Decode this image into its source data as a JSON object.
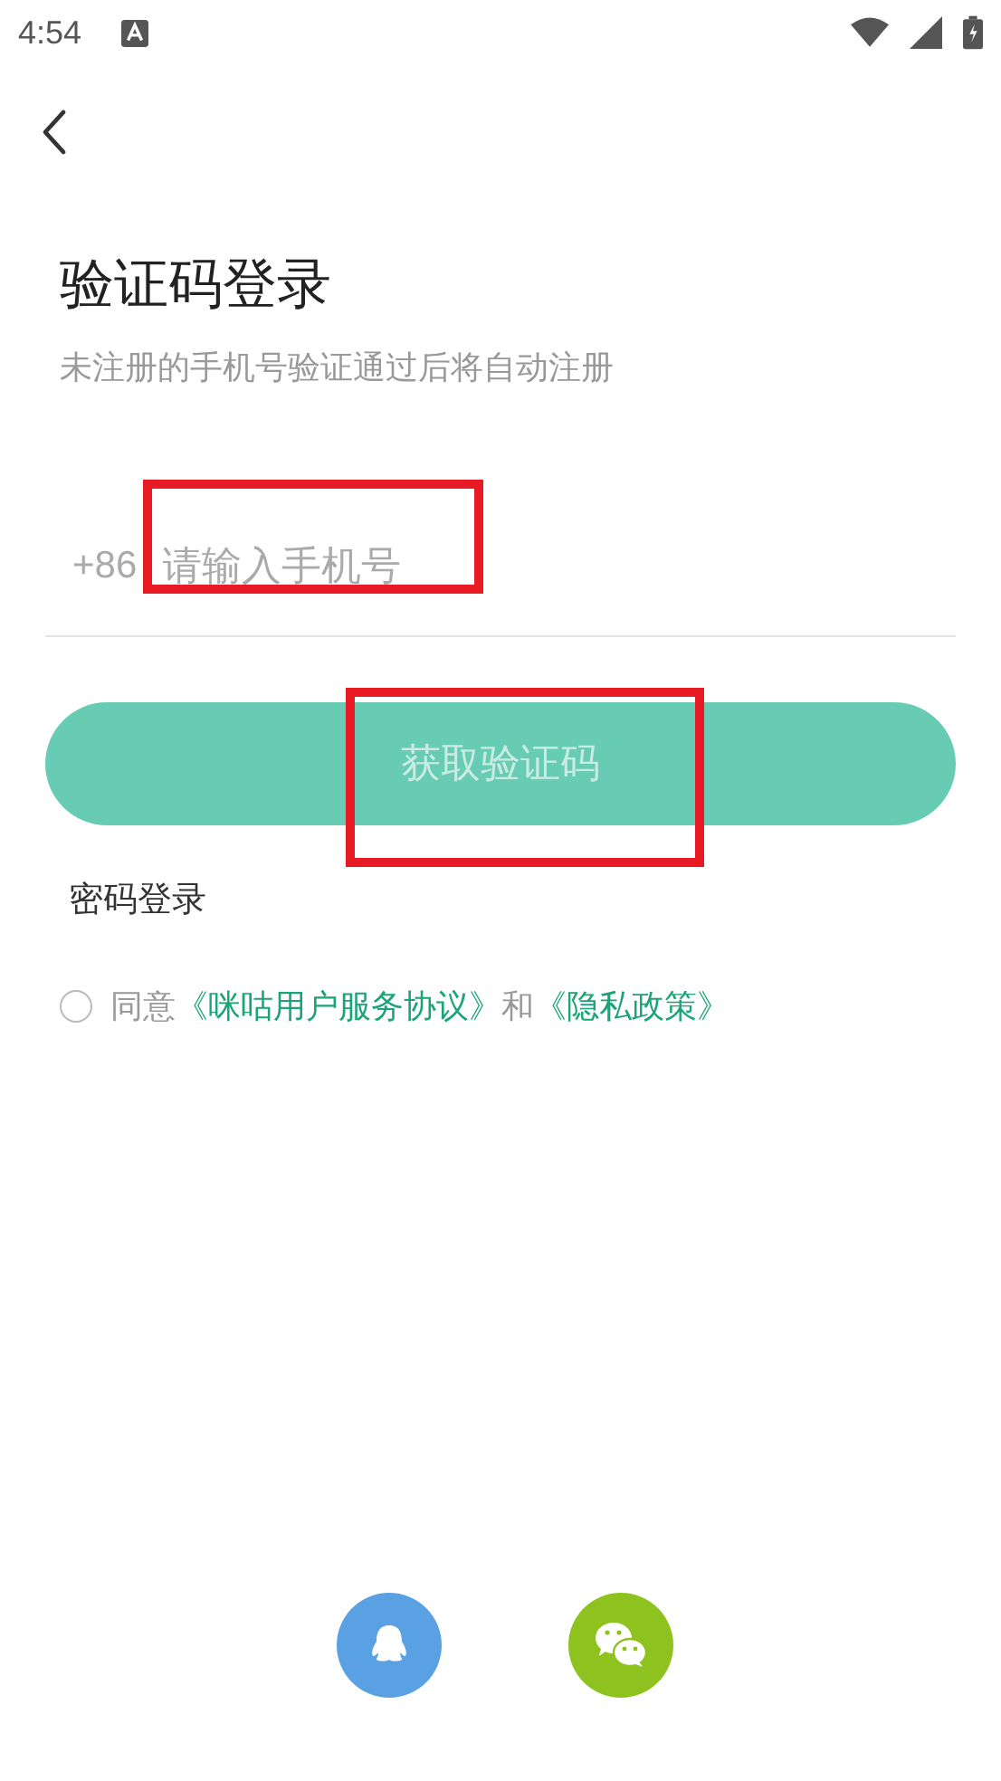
{
  "status_bar": {
    "time": "4:54"
  },
  "title": "验证码登录",
  "subtitle": "未注册的手机号验证通过后将自动注册",
  "phone": {
    "prefix": "+86",
    "placeholder": "请输入手机号"
  },
  "submit_button": {
    "label": "获取验证码",
    "disabled": true
  },
  "password_login": "密码登录",
  "agreement": {
    "checked": false,
    "prefix": "同意",
    "links": [
      "《咪咕用户服务协议》",
      "《隐私政策》"
    ],
    "joiner": "和"
  },
  "social_logins": [
    {
      "kind": "qq",
      "color": "#5aa1e3"
    },
    {
      "kind": "wechat",
      "color": "#8ec21f"
    }
  ]
}
